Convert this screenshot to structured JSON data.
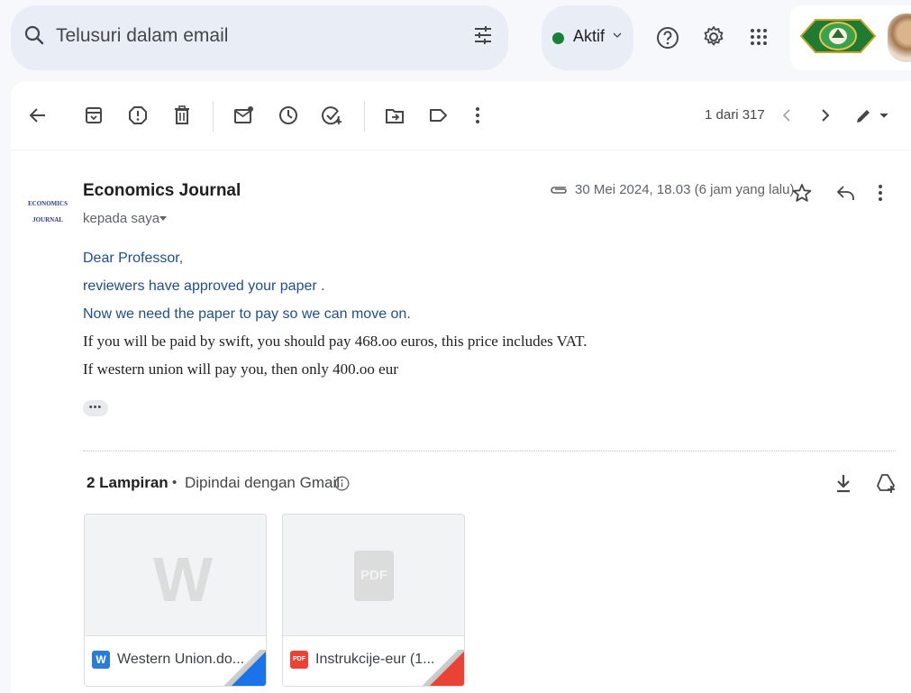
{
  "search": {
    "placeholder": "Telusuri dalam email",
    "icon": "search-icon",
    "filter_icon": "tune-icon"
  },
  "status": {
    "label": "Aktif",
    "color": "#188038"
  },
  "header_icons": [
    "help-icon",
    "gear-icon",
    "apps-icon"
  ],
  "toolbar": {
    "icons": [
      "back-arrow-icon",
      "archive-icon",
      "report-spam-icon",
      "delete-icon",
      "mark-unread-icon",
      "snooze-icon",
      "add-task-icon",
      "move-to-icon",
      "label-icon",
      "more-vertical-icon"
    ],
    "counter": "1 dari 317",
    "nav_icons": [
      "chevron-left-icon",
      "chevron-right-icon",
      "pen-icon"
    ]
  },
  "message": {
    "sender_logo_line1": "ECONOMICS",
    "sender_logo_line2": "JOURNAL",
    "sender_name": "Economics Journal",
    "recipient": "kepada saya",
    "timestamp": "30 Mei 2024, 18.03 (6 jam yang lalu)",
    "body": {
      "line1": "Dear Professor,",
      "line2": "reviewers have approved your paper .",
      "line3": "Now we need the paper to pay so we can move on.",
      "line4": "If you will be paid by swift, you should pay 468.oo euros, this price includes VAT.",
      "line5": "If western union will pay you, then only 400.oo eur"
    },
    "ellipsis": "•••"
  },
  "attachments": {
    "count_label": "2 Lampiran",
    "separator": "•",
    "scan_label": "Dipindai dengan Gmail",
    "items": [
      {
        "name": "Western Union.do...",
        "type_badge": "W",
        "preview_glyph": "W",
        "color": "#2b7cd3",
        "fold_color": "#1a73e8"
      },
      {
        "name": "Instrukcije-eur (1...",
        "type_badge": "PDF",
        "preview_glyph": "PDF",
        "color": "#ea4335",
        "fold_color": "#ea4335"
      }
    ]
  }
}
